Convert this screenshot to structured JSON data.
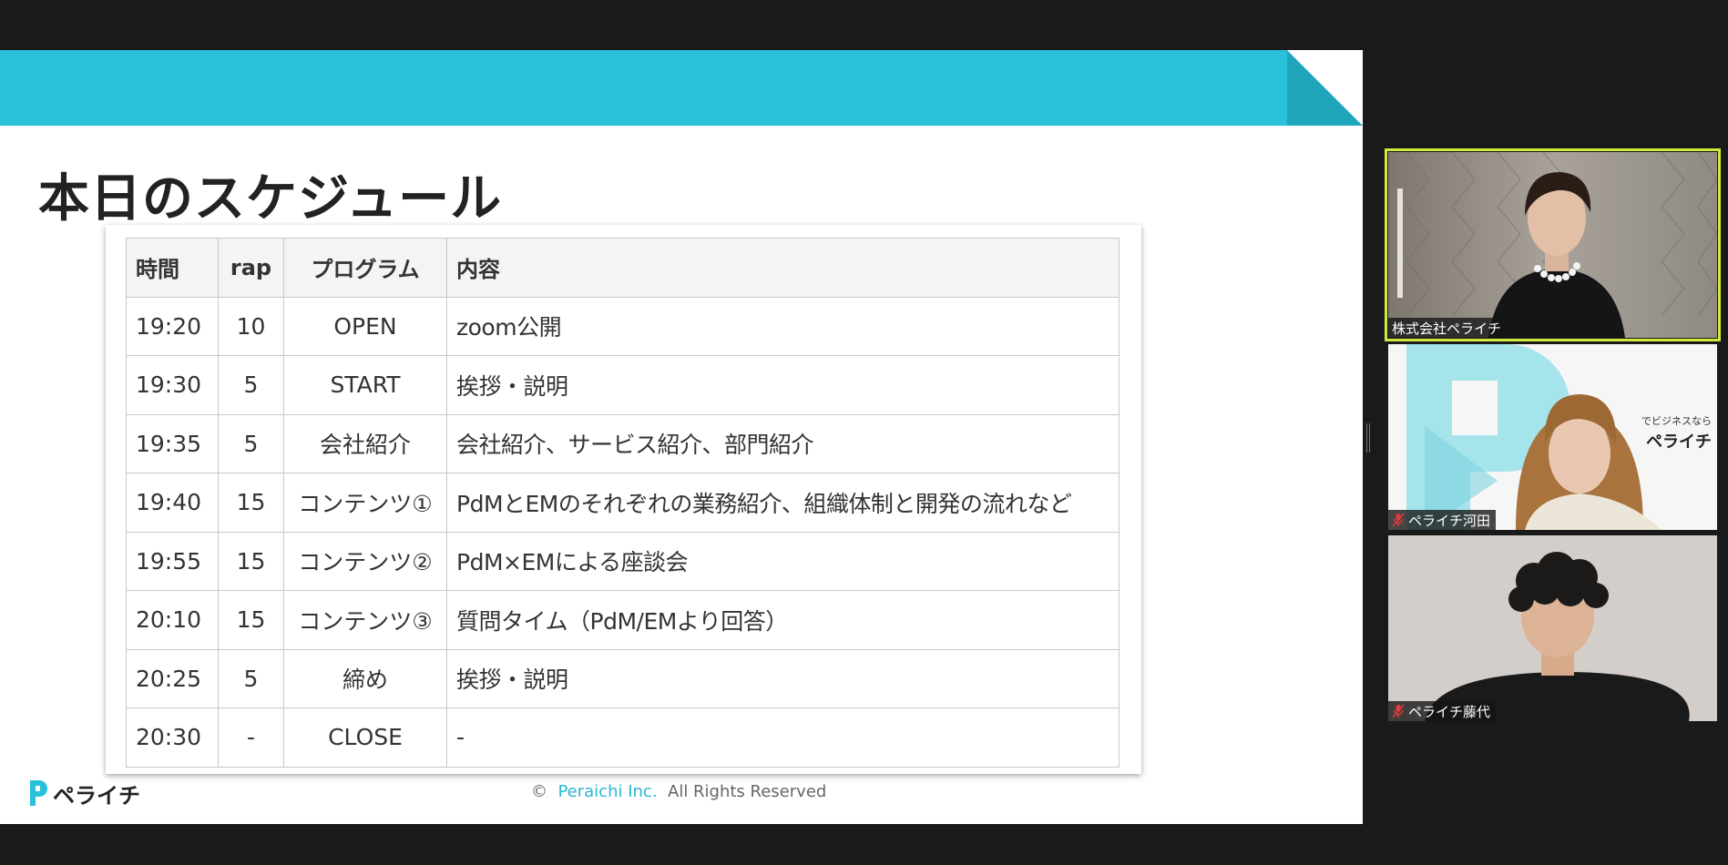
{
  "slide": {
    "title": "本日のスケジュール",
    "table": {
      "headers": [
        "時間",
        "rap",
        "プログラム",
        "内容"
      ],
      "rows": [
        [
          "19:20",
          "10",
          "OPEN",
          "zoom公開"
        ],
        [
          "19:30",
          "5",
          "START",
          "挨拶・説明"
        ],
        [
          "19:35",
          "5",
          "会社紹介",
          "会社紹介、サービス紹介、部門紹介"
        ],
        [
          "19:40",
          "15",
          "コンテンツ①",
          "PdMとEMのそれぞれの業務紹介、組織体制と開発の流れなど"
        ],
        [
          "19:55",
          "15",
          "コンテンツ②",
          "PdM×EMによる座談会"
        ],
        [
          "20:10",
          "15",
          "コンテンツ③",
          "質問タイム（PdM/EMより回答）"
        ],
        [
          "20:25",
          "5",
          "締め",
          "挨拶・説明"
        ],
        [
          "20:30",
          "-",
          "CLOSE",
          "-"
        ]
      ]
    },
    "logo_text": "ペライチ",
    "copyright": {
      "symbol": "©",
      "brand": "Peraichi Inc.",
      "rest": "All Rights Reserved"
    },
    "colors": {
      "band": "#29c0d9",
      "corner": "#1fa6bd",
      "brand_text": "#29b8d0"
    }
  },
  "participants": [
    {
      "name": "株式会社ペライチ",
      "muted": false,
      "active": true
    },
    {
      "name": "ペライチ河田",
      "muted": true,
      "active": false,
      "background_text": [
        "でビジネスなら",
        "ペライチ"
      ]
    },
    {
      "name": "ペライチ藤代",
      "muted": true,
      "active": false
    }
  ]
}
